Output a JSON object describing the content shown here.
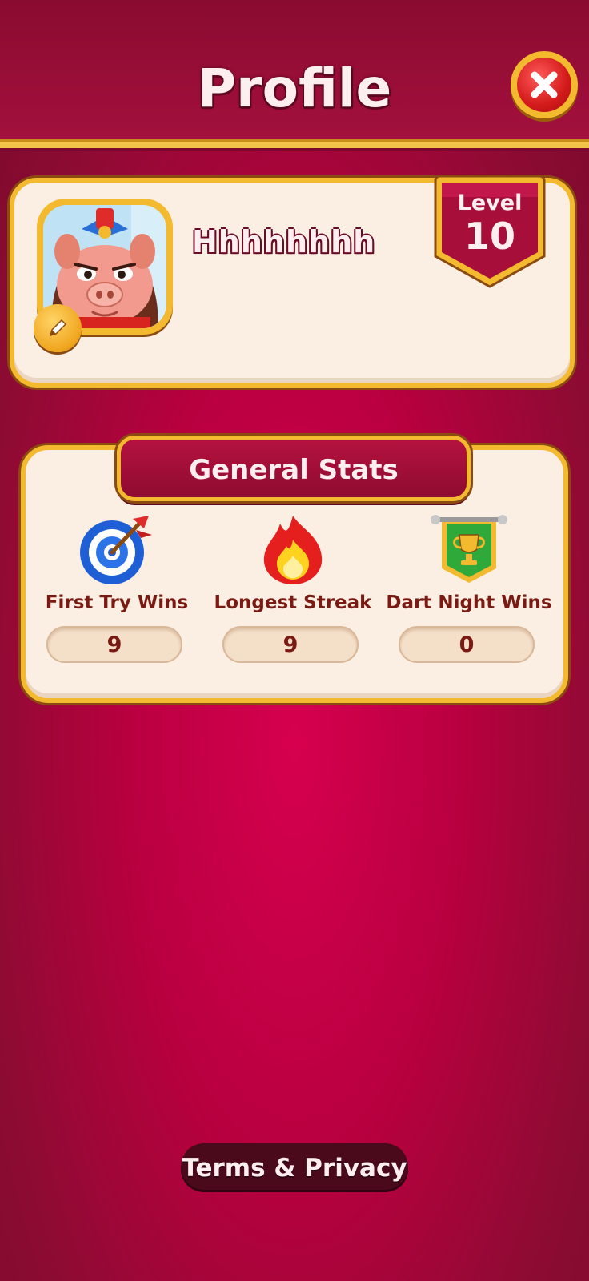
{
  "header": {
    "title": "Profile"
  },
  "profile": {
    "username": "Hhhhhhhh",
    "level_label": "Level",
    "level_value": "10"
  },
  "stats": {
    "title": "General Stats",
    "items": [
      {
        "label": "First Try Wins",
        "value": "9",
        "icon": "target-dart-icon"
      },
      {
        "label": "Longest Streak",
        "value": "9",
        "icon": "flame-icon"
      },
      {
        "label": "Dart Night Wins",
        "value": "0",
        "icon": "trophy-banner-icon"
      }
    ]
  },
  "footer": {
    "terms_label": "Terms & Privacy"
  },
  "colors": {
    "background": "#b8003f",
    "gold_border": "#f3b92f",
    "card": "#fbeee2",
    "text_dark": "#7a1a12"
  }
}
